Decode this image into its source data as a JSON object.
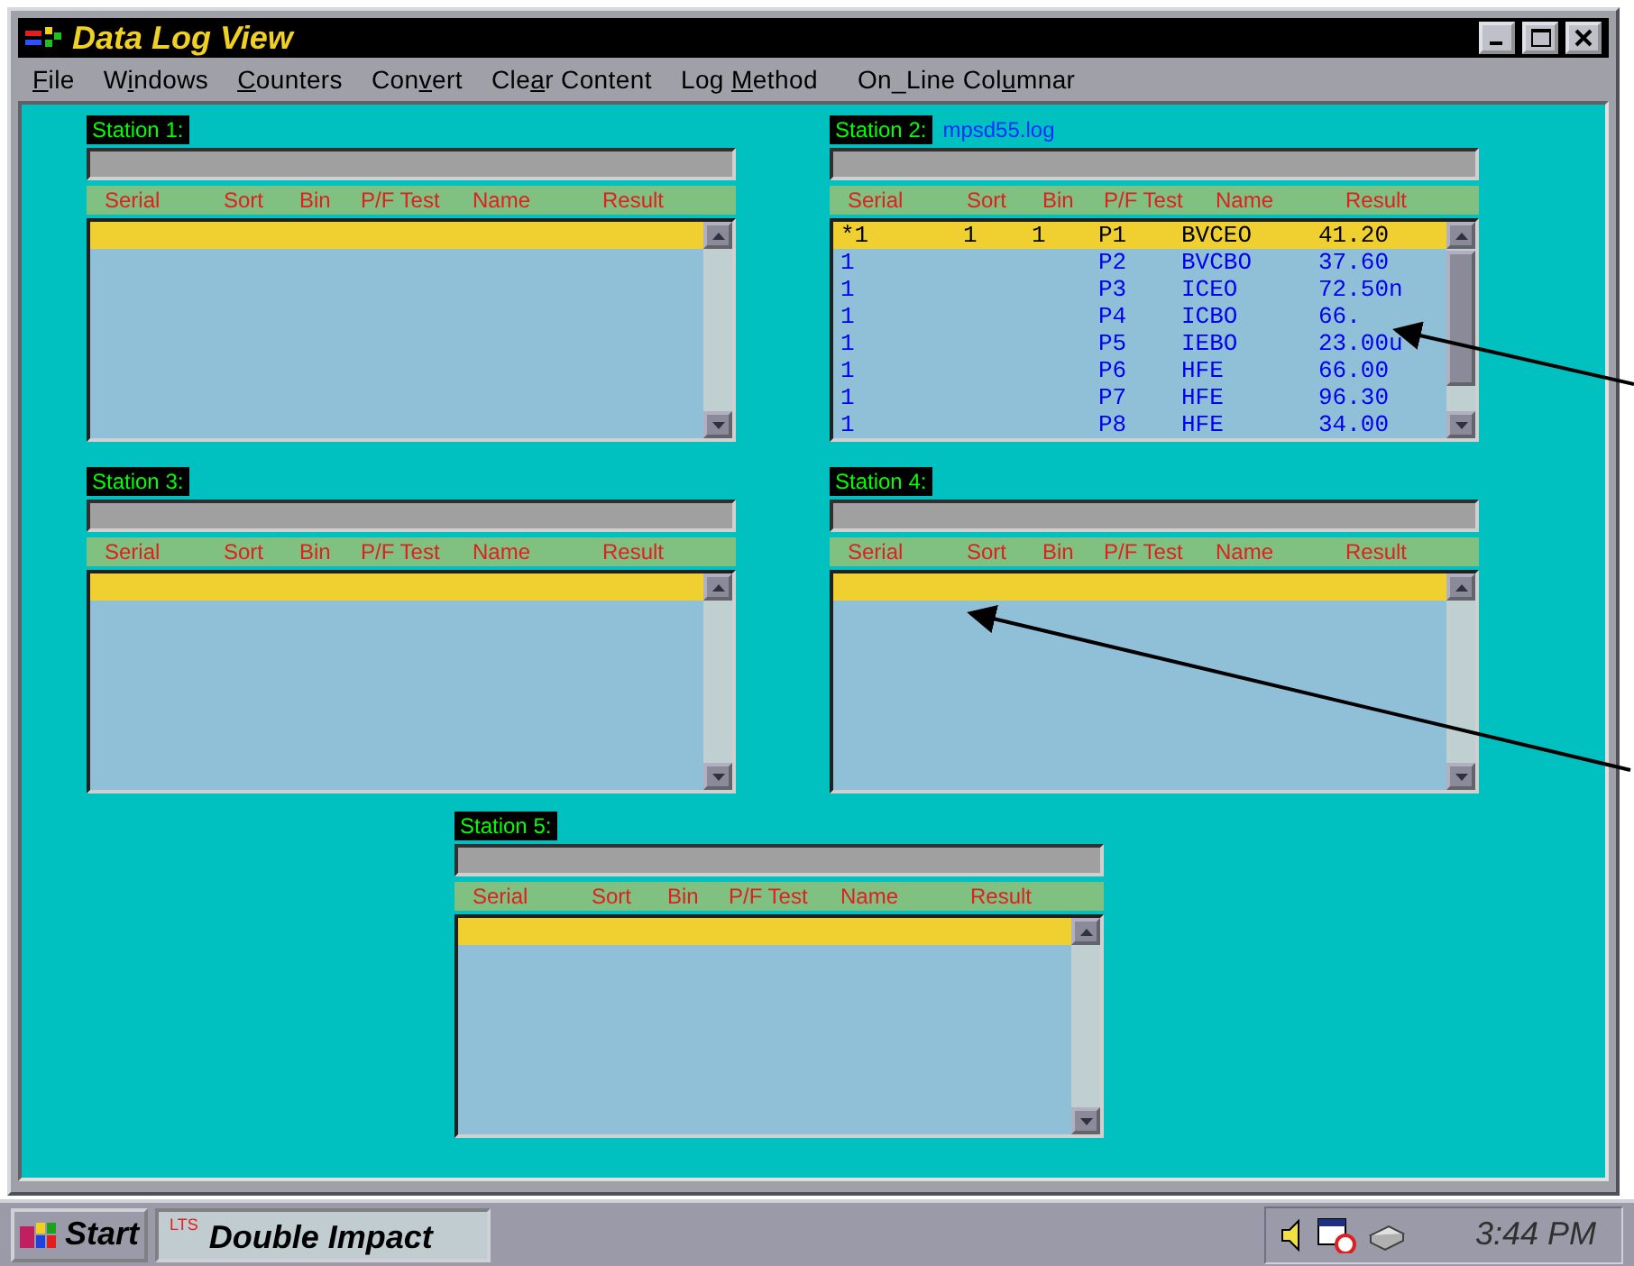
{
  "window": {
    "title": "Data Log View"
  },
  "menu": [
    {
      "key": "F",
      "post": "ile"
    },
    {
      "pre": "W",
      "key": "i",
      "post": "ndows"
    },
    {
      "key": "C",
      "post": "ounters"
    },
    {
      "pre": "Con",
      "key": "v",
      "post": "ert"
    },
    {
      "pre": "Cle",
      "key": "a",
      "post": "r Content"
    },
    {
      "pre": "Log ",
      "key": "M",
      "post": "ethod"
    },
    {
      "pre": "On_Line Col",
      "key": "u",
      "post": "mnar"
    }
  ],
  "stations": [
    {
      "label": "Station 1:",
      "columns": [
        "Serial",
        "Sort",
        "Bin",
        "P/F Test",
        "Name",
        "Result"
      ]
    },
    {
      "label": "Station 2:",
      "file": "mpsd55.log",
      "columns": [
        "Serial",
        "Sort",
        "Bin",
        "P/F Test",
        "Name",
        "Result"
      ],
      "rows": [
        {
          "serial": "*1",
          "sort": "1",
          "bin": "1",
          "test": "P1",
          "name": "BVCEO",
          "result": "41.20",
          "selected": true
        },
        {
          "serial": "1",
          "test": "P2",
          "name": "BVCBO",
          "result": "37.60",
          "selected": false
        },
        {
          "serial": "1",
          "test": "P3",
          "name": "ICEO",
          "result": "72.50n",
          "selected": false
        },
        {
          "serial": "1",
          "test": "P4",
          "name": "ICBO",
          "result": "66.",
          "selected": false
        },
        {
          "serial": "1",
          "test": "P5",
          "name": "IEBO",
          "result": "23.00u",
          "selected": false
        },
        {
          "serial": "1",
          "test": "P6",
          "name": "HFE",
          "result": "66.00",
          "selected": false
        },
        {
          "serial": "1",
          "test": "P7",
          "name": "HFE",
          "result": "96.30",
          "selected": false
        },
        {
          "serial": "1",
          "test": "P8",
          "name": "HFE",
          "result": "34.00",
          "selected": false
        }
      ]
    },
    {
      "label": "Station 3:",
      "columns": [
        "Serial",
        "Sort",
        "Bin",
        "P/F Test",
        "Name",
        "Result"
      ]
    },
    {
      "label": "Station 4:",
      "columns": [
        "Serial",
        "Sort",
        "Bin",
        "P/F Test",
        "Name",
        "Result"
      ]
    },
    {
      "label": "Station 5:",
      "columns": [
        "Serial",
        "Sort",
        "Bin",
        "P/F Test",
        "Name",
        "Result"
      ]
    }
  ],
  "taskbar": {
    "start": "Start",
    "task": {
      "badge": "LTS",
      "label": "Double Impact"
    },
    "clock": "3:44 PM"
  }
}
